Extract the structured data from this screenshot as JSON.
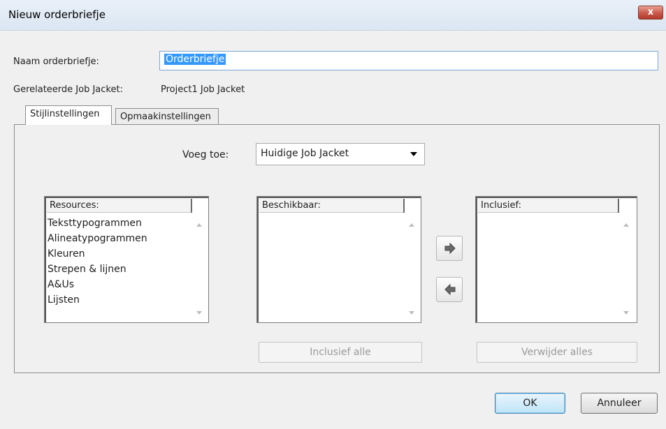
{
  "window": {
    "title": "Nieuw orderbriefje",
    "close_glyph": "x"
  },
  "form": {
    "name_label": "Naam orderbriefje:",
    "name_value": "Orderbriefje",
    "related_label": "Gerelateerde Job Jacket:",
    "related_value": "Project1 Job Jacket"
  },
  "tabs": [
    {
      "label": "Stijlinstellingen",
      "active": true
    },
    {
      "label": "Opmaakinstellingen",
      "active": false
    }
  ],
  "add": {
    "label": "Voeg toe:",
    "selected": "Huidige Job Jacket"
  },
  "lists": {
    "resources": {
      "header": "Resources:",
      "items": [
        "Teksttypogrammen",
        "Alineatypogrammen",
        "Kleuren",
        "Strepen & lijnen",
        "A&Us",
        "Lijsten"
      ]
    },
    "available": {
      "header": "Beschikbaar:"
    },
    "included": {
      "header": "Inclusief:"
    }
  },
  "buttons": {
    "include_all": "Inclusief alle",
    "remove_all": "Verwijder alles",
    "ok": "OK",
    "cancel": "Annuleer"
  },
  "icons": {
    "add_arrow": "arrow-right-icon",
    "remove_arrow": "arrow-left-icon",
    "dropdown": "chevron-down-icon",
    "close": "close-icon"
  }
}
